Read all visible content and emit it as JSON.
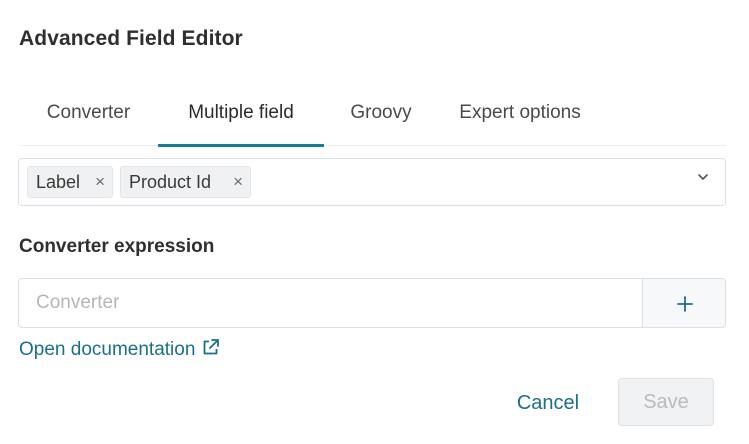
{
  "dialog": {
    "title": "Advanced Field Editor"
  },
  "tabs": [
    {
      "label": "Converter",
      "active": false
    },
    {
      "label": "Multiple field",
      "active": true
    },
    {
      "label": "Groovy",
      "active": false
    },
    {
      "label": "Expert options",
      "active": false
    }
  ],
  "fields": {
    "selected": [
      {
        "label": "Label",
        "remove_icon": "close-icon"
      },
      {
        "label": "Product Id",
        "remove_icon": "close-icon"
      }
    ],
    "dropdown_icon": "chevron-down-icon"
  },
  "converter": {
    "section_label": "Converter expression",
    "value": "",
    "placeholder": "Converter",
    "add_icon": "plus-icon"
  },
  "documentation": {
    "link_label": "Open documentation",
    "icon": "external-link-icon"
  },
  "actions": {
    "cancel_label": "Cancel",
    "save_label": "Save",
    "save_enabled": false
  },
  "colors": {
    "accent": "#1a7b96",
    "link": "#1a6f8c",
    "border": "#dcdfe3",
    "disabled_text": "#b8bbbe"
  }
}
